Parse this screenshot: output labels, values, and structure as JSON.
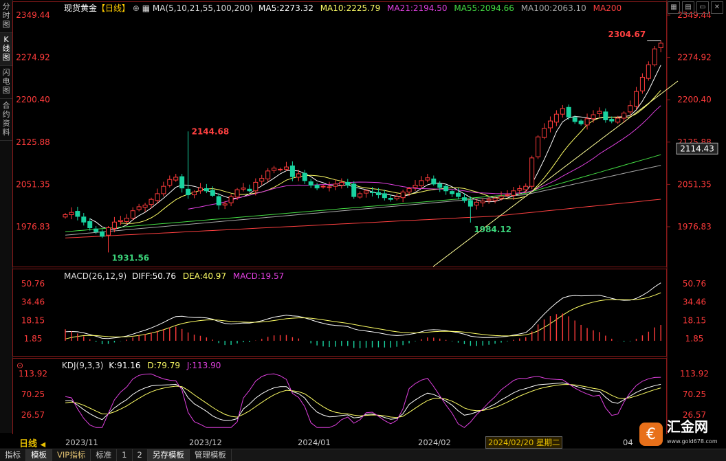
{
  "side_tabs": [
    "分时图",
    "K线图",
    "闪电图",
    "合约资料"
  ],
  "header": {
    "symbol": "现货黄金",
    "period": "【日线】",
    "ma_label": "MA(5,10,21,55,100,200)",
    "ma5": "MA5:2273.32",
    "ma10": "MA10:2225.79",
    "ma21": "MA21:2194.50",
    "ma55": "MA55:2094.66",
    "ma100": "MA100:2063.10",
    "ma200": "MA200"
  },
  "macd_header": {
    "label": "MACD(26,12,9)",
    "diff": "DIFF:50.76",
    "dea": "DEA:40.97",
    "macd": "MACD:19.57"
  },
  "kdj_header": {
    "label": "KDJ(9,3,3)",
    "k": "K:91.16",
    "d": "D:79.79",
    "j": "J:113.90"
  },
  "colors": {
    "up": "#ff3b3b",
    "down": "#19d3a0",
    "ma5": "#ffffff",
    "ma10": "#ffff66",
    "ma21": "#e040e0",
    "ma55": "#44dd44",
    "ma100": "#a8a8a8",
    "ma200": "#ff4040",
    "label_high": "#ff4040",
    "label_low": "#3bd37a"
  },
  "chart_data": {
    "type": "candlestick",
    "price_axis": {
      "ticks": [
        "2349.44",
        "2274.92",
        "2200.40",
        "2125.88",
        "2051.35",
        "1976.83"
      ],
      "current": "2114.43"
    },
    "macd_axis": {
      "ticks": [
        "50.76",
        "34.46",
        "18.15",
        "1.85"
      ]
    },
    "kdj_axis": {
      "ticks": [
        "113.92",
        "70.25",
        "26.57"
      ]
    },
    "annotations": {
      "high_label": "2304.67",
      "mid_high_label": "2144.68",
      "low1_label": "1931.56",
      "low2_label": "1984.12"
    },
    "x_ticks": [
      "2023/11",
      "2023/12",
      "2024/01",
      "2024/02"
    ],
    "cursor_date": "2024/02/20 星期二",
    "last_tick_fragment": "04",
    "closes": [
      1998,
      2002,
      1995,
      1985,
      1975,
      1968,
      1960,
      1975,
      1985,
      1988,
      1992,
      2005,
      2012,
      2015,
      2025,
      2035,
      2048,
      2060,
      2064,
      2045,
      2033,
      2038,
      2045,
      2040,
      2032,
      2015,
      2017,
      2030,
      2042,
      2045,
      2040,
      2055,
      2062,
      2075,
      2080,
      2078,
      2082,
      2065,
      2070,
      2058,
      2050,
      2045,
      2048,
      2047,
      2052,
      2055,
      2050,
      2030,
      2035,
      2040,
      2037,
      2033,
      2028,
      2025,
      2030,
      2038,
      2044,
      2050,
      2058,
      2063,
      2052,
      2046,
      2040,
      2035,
      2030,
      2023,
      2013,
      2020,
      2022,
      2025,
      2027,
      2030,
      2033,
      2040,
      2044,
      2048,
      2098,
      2135,
      2150,
      2163,
      2175,
      2185,
      2170,
      2162,
      2158,
      2167,
      2174,
      2180,
      2165,
      2163,
      2168,
      2177,
      2190,
      2215,
      2240,
      2262,
      2290,
      2300
    ]
  },
  "bottom_tabs": [
    "指标",
    "模板",
    "VIP指标",
    "标准",
    "1",
    "2",
    "另存模板",
    "管理模板"
  ],
  "date_bar": {
    "period_btn": "日线"
  },
  "logo": {
    "name": "汇金网",
    "url": "www.gold678.com"
  }
}
